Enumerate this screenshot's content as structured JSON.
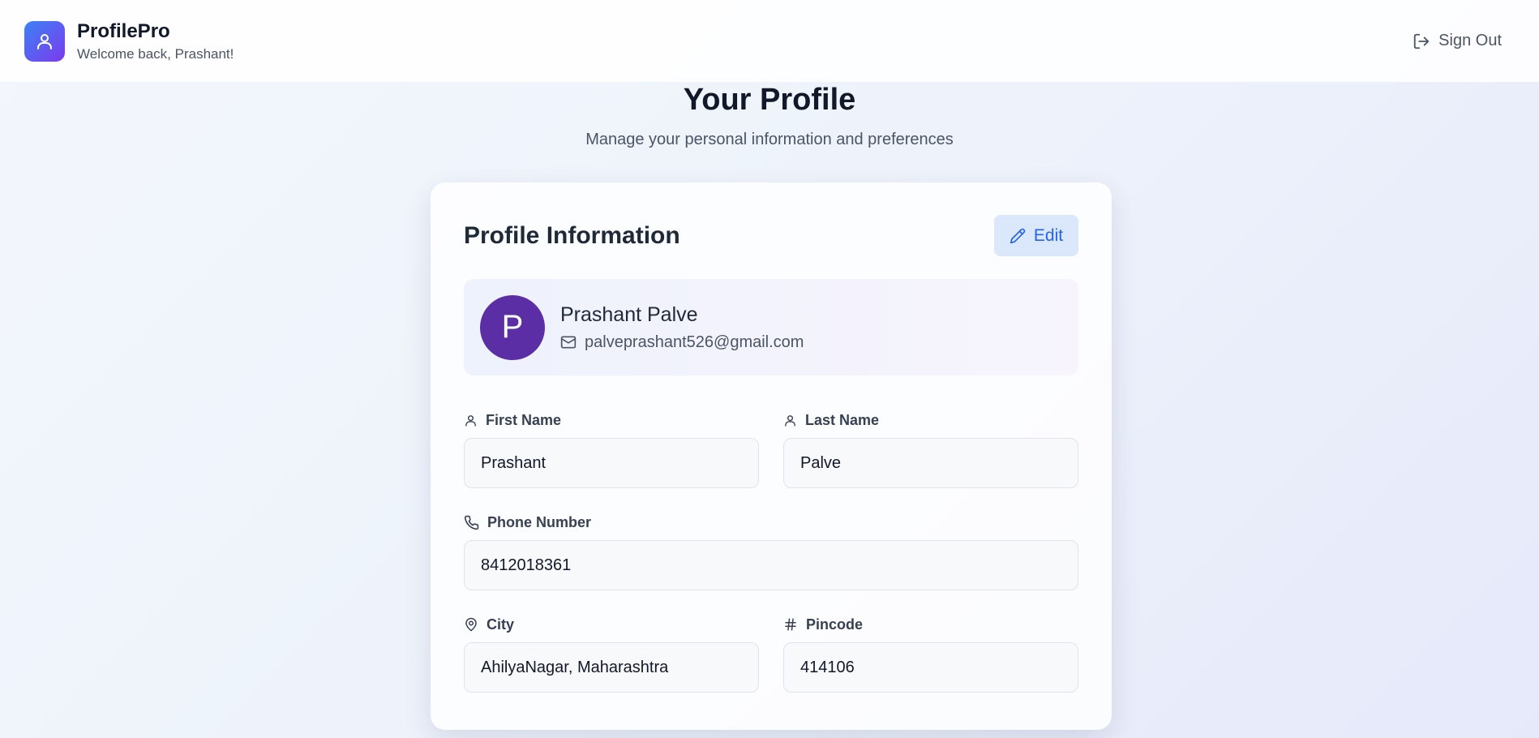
{
  "header": {
    "app_name": "ProfilePro",
    "welcome": "Welcome back, Prashant!",
    "signout_label": "Sign Out",
    "logo_icon": "user-icon",
    "signout_icon": "log-out-icon"
  },
  "page": {
    "title": "Your Profile",
    "subtitle": "Manage your personal information and preferences"
  },
  "card": {
    "title": "Profile Information",
    "edit_label": "Edit",
    "edit_icon": "pencil-icon"
  },
  "user": {
    "initial": "P",
    "full_name": "Prashant Palve",
    "email": "palveprashant526@gmail.com"
  },
  "fields": {
    "first_name": {
      "label": "First Name",
      "value": "Prashant",
      "icon": "user-icon"
    },
    "last_name": {
      "label": "Last Name",
      "value": "Palve",
      "icon": "user-icon"
    },
    "phone": {
      "label": "Phone Number",
      "value": "8412018361",
      "icon": "phone-icon"
    },
    "city": {
      "label": "City",
      "value": "AhilyaNagar, Maharashtra",
      "icon": "map-pin-icon"
    },
    "pincode": {
      "label": "Pincode",
      "value": "414106",
      "icon": "hash-icon"
    }
  },
  "colors": {
    "accent": "#2563eb",
    "avatar_bg": "#5b2ea6",
    "logo_gradient_start": "#3b82f6",
    "logo_gradient_end": "#7c3aed"
  }
}
